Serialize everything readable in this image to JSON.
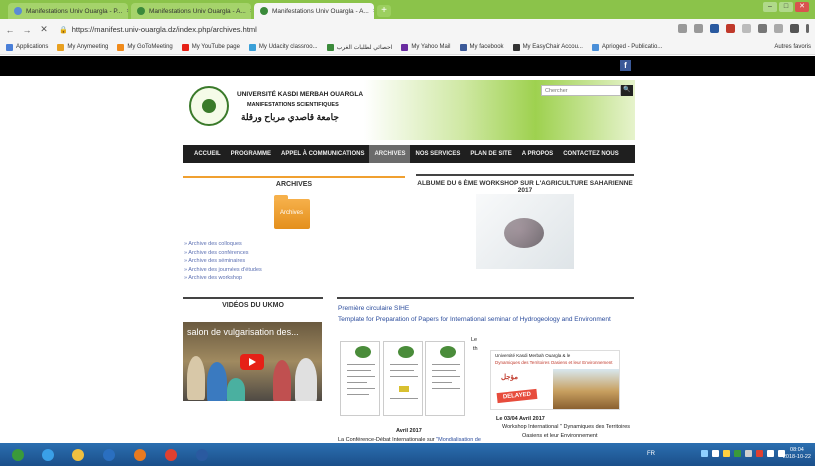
{
  "browser": {
    "tabs": [
      {
        "title": "Manifestations Univ Ouargla - P...",
        "active": false,
        "favicon_color": "#5b8bd6"
      },
      {
        "title": "Manifestations Univ Ouargla - A...",
        "active": false,
        "favicon_color": "#3a8a3a"
      },
      {
        "title": "Manifestations Univ Ouargla - A...",
        "active": true,
        "favicon_color": "#3a8a3a"
      }
    ],
    "tab_close": "×",
    "new_tab": "+",
    "window_controls": [
      "–",
      "□",
      "✕"
    ],
    "nav": {
      "back": "←",
      "forward": "→",
      "reload": "✕"
    },
    "url": "https://manifest.univ-ouargla.dz/index.php/archives.html",
    "lock": "🔒",
    "bookmarks": [
      {
        "label": "Applications",
        "color": "#4a7fd8"
      },
      {
        "label": "My Anymeeting",
        "color": "#e8a020"
      },
      {
        "label": "My GoToMeeting",
        "color": "#f08a1a"
      },
      {
        "label": "My YouTube page",
        "color": "#e62117"
      },
      {
        "label": "My Udacity classroo...",
        "color": "#3aa0d8"
      },
      {
        "label": "احصائي لطلبات الغرب",
        "color": "#3a8a3a"
      },
      {
        "label": "My Yahoo Mail",
        "color": "#6a2ca0"
      },
      {
        "label": "My facebook",
        "color": "#3b5998"
      },
      {
        "label": "My EasyChair Accou...",
        "color": "#333333"
      },
      {
        "label": "Aprioged - Publicatio...",
        "color": "#4a8fd8"
      }
    ],
    "other_bookmarks": "Autres favoris"
  },
  "site": {
    "facebook_icon": "f",
    "header": {
      "line1": "UNIVERSITÉ KASDI MERBAH OUARGLA",
      "line2": "MANIFESTATIONS SCIENTIFIQUES",
      "arabic": "جامعة قاصدي مرباح ورقلة",
      "search_placeholder": "Chercher",
      "search_icon": "🔍"
    },
    "menu": [
      {
        "label": "ACCUEIL",
        "active": false
      },
      {
        "label": "PROGRAMME",
        "active": false
      },
      {
        "label": "APPEL À COMMUNICATIONS",
        "active": false
      },
      {
        "label": "ARCHIVES",
        "active": true
      },
      {
        "label": "NOS SERVICES",
        "active": false
      },
      {
        "label": "PLAN DE SITE",
        "active": false
      },
      {
        "label": "A PROPOS",
        "active": false
      },
      {
        "label": "CONTACTEZ NOUS",
        "active": false
      }
    ],
    "archives": {
      "title": "ARCHIVES",
      "folder_label": "Archives",
      "items": [
        "» Archive des colloques",
        "» Archive des conférences",
        "» Archive des séminaires",
        "» Archive des journées d'études",
        "» Archive des workshop"
      ]
    },
    "album": {
      "title": "ALBUME DU 6 ÈME WORKSHOP SUR L'AGRICULTURE SAHARIENNE 2017"
    },
    "videos": {
      "title": "VIDÉOS DU UKMO",
      "video_title": "salon de vulgarisation des..."
    },
    "news": {
      "link1": "Première circulaire SIHE",
      "link2": "Template for Preparation of Papers for International seminar of Hydrogeology and Environment",
      "frag1": "Le",
      "frag2": "th",
      "april_label": "Avril 2017",
      "conference_text": "La Conférence-Débat Internationale sur ",
      "conference_link": "\"Mondialisation de",
      "date2": "Le 03/04 Avril 2017",
      "workshop_line1": "Workshop International \" Dynamiques des Territoires",
      "workshop_line2": "Oasiens et leur Environnement",
      "poster_head": "Université Kasdi Merbah Ouargla & le",
      "poster_sub": "Dynamiques des Territoires Oasiens et leur Environnement",
      "postponed_ar": "مؤجل",
      "delayed": "DELAYED"
    }
  },
  "taskbar": {
    "apps": [
      {
        "name": "start",
        "color": "#3a9a3a"
      },
      {
        "name": "ie",
        "color": "#3aa0e8"
      },
      {
        "name": "explorer",
        "color": "#f0c040"
      },
      {
        "name": "outlook",
        "color": "#2a6fc0"
      },
      {
        "name": "media",
        "color": "#e87a20"
      },
      {
        "name": "chrome",
        "color": "#e04030"
      },
      {
        "name": "word",
        "color": "#2a5aa0"
      }
    ],
    "lang": "FR",
    "time": "08:04",
    "date": "2018-10-22"
  }
}
